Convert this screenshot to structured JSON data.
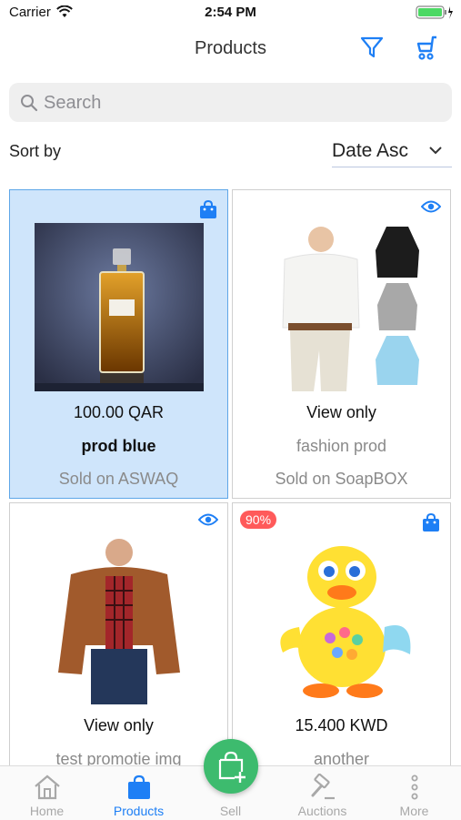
{
  "status_bar": {
    "carrier": "Carrier",
    "time": "2:54 PM"
  },
  "nav": {
    "title": "Products",
    "filter_icon": "filter-icon",
    "cart_icon": "cart-icon"
  },
  "search": {
    "placeholder": "Search"
  },
  "sort": {
    "label": "Sort by",
    "value": "Date Asc"
  },
  "products": [
    {
      "price": "100.00 QAR",
      "name": "prod blue",
      "source": "Sold on ASWAQ",
      "badge": "shopping-bag-icon",
      "image": "perfume-bottle",
      "selected": true
    },
    {
      "price": "View only",
      "name": "fashion prod",
      "source": "Sold on SoapBOX",
      "badge": "eye-icon",
      "image": "white-sweater-outfit"
    },
    {
      "price": "View only",
      "name": "test promotie img",
      "badge": "eye-icon",
      "image": "man-in-jacket"
    },
    {
      "price": "15.400 KWD",
      "name": "another",
      "discount": "90%",
      "badge": "shopping-bag-icon",
      "image": "toy-duck"
    }
  ],
  "tabs": [
    {
      "label": "Home",
      "icon": "home-icon"
    },
    {
      "label": "Products",
      "icon": "shopping-bag-icon",
      "active": true
    },
    {
      "label": "Sell",
      "icon": "add-to-bag-icon"
    },
    {
      "label": "Auctions",
      "icon": "gavel-icon"
    },
    {
      "label": "More",
      "icon": "more-vertical-icon"
    }
  ],
  "colors": {
    "accent": "#1e7ff5",
    "selected_card": "#cfe5fb",
    "sell_button": "#3dbb6e",
    "discount_badge": "#ff5a5a"
  }
}
